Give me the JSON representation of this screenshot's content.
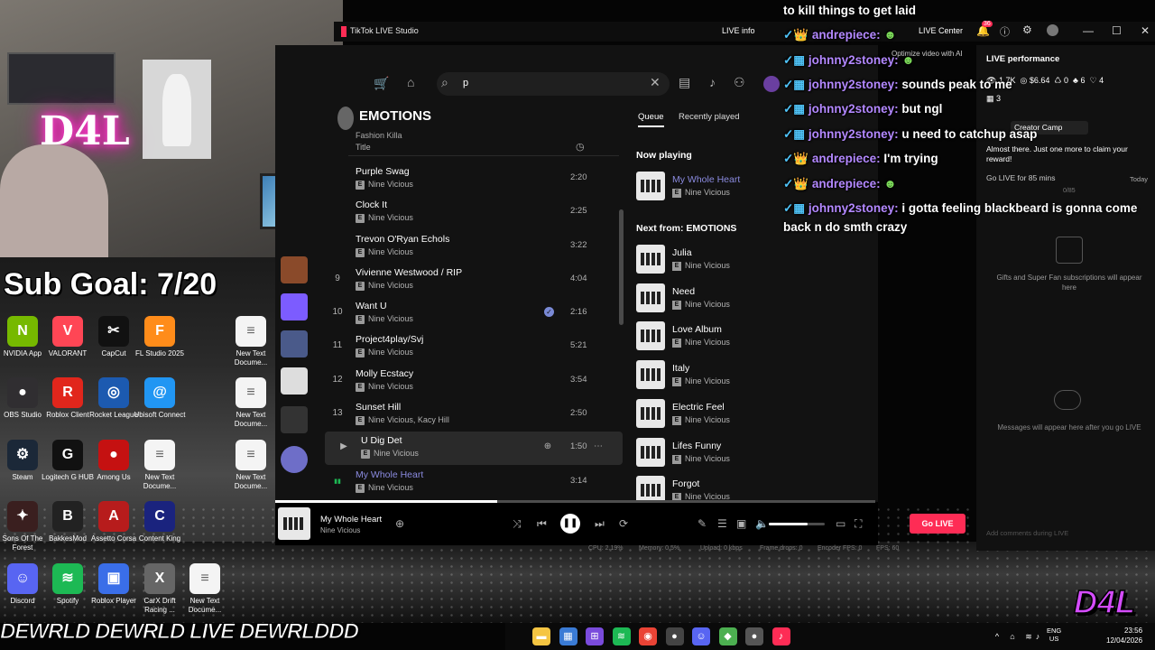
{
  "webcam": {
    "neon_sign": "D4L"
  },
  "overlay": {
    "sub_goal": "Sub Goal: 7/20"
  },
  "desktop_icons": [
    {
      "label": "NVIDIA App",
      "color": "#76b900",
      "glyph": "N"
    },
    {
      "label": "VALORANT",
      "color": "#ff4655",
      "glyph": "V"
    },
    {
      "label": "CapCut",
      "color": "#111111",
      "glyph": "✂"
    },
    {
      "label": "FL Studio 2025",
      "color": "#ff8c1a",
      "glyph": "F"
    },
    {
      "label": "New Text Docume...",
      "color": "#f4f4f4",
      "glyph": "≡"
    },
    {
      "label": "OBS Studio",
      "color": "#302e31",
      "glyph": "●"
    },
    {
      "label": "Roblox Client",
      "color": "#e1261c",
      "glyph": "R"
    },
    {
      "label": "Rocket League",
      "color": "#1c5ab0",
      "glyph": "◎"
    },
    {
      "label": "Ubisoft Connect",
      "color": "#2196f3",
      "glyph": "@"
    },
    {
      "label": "New Text Docume...",
      "color": "#f4f4f4",
      "glyph": "≡"
    },
    {
      "label": "Steam",
      "color": "#1b2838",
      "glyph": "⚙"
    },
    {
      "label": "Logitech G HUB",
      "color": "#111111",
      "glyph": "G"
    },
    {
      "label": "Among Us",
      "color": "#c51111",
      "glyph": "●"
    },
    {
      "label": "New Text Docume...",
      "color": "#f4f4f4",
      "glyph": "≡"
    },
    {
      "label": "New Text Docume...",
      "color": "#f4f4f4",
      "glyph": "≡"
    },
    {
      "label": "Sons Of The Forest",
      "color": "#3a1f1f",
      "glyph": "✦"
    },
    {
      "label": "BakkesMod",
      "color": "#222222",
      "glyph": "B"
    },
    {
      "label": "Assetto Corsa",
      "color": "#b71c1c",
      "glyph": "A"
    },
    {
      "label": "Content King",
      "color": "#1a237e",
      "glyph": "C"
    },
    {
      "label": "Discord",
      "color": "#5865f2",
      "glyph": "☺"
    },
    {
      "label": "Spotify",
      "color": "#1db954",
      "glyph": "≋"
    },
    {
      "label": "Roblox Player",
      "color": "#3a6ee8",
      "glyph": "▣"
    },
    {
      "label": "CarX Drift Racing ...",
      "color": "#666666",
      "glyph": "X"
    },
    {
      "label": "New Text Docume...",
      "color": "#f4f4f4",
      "glyph": "≡"
    }
  ],
  "tiktok": {
    "app_title": "TikTok LIVE Studio",
    "live_info": "LIVE info",
    "live_center": "LIVE Center",
    "notification_count": "36",
    "optimize_label": "Optimize video with AI",
    "live_performance": "LIVE performance",
    "stats": {
      "viewers": "1.7K",
      "earnings": "$6.64",
      "shares": "0",
      "gifts": "6",
      "likes": "4",
      "fans": "3"
    },
    "creator_camp": "Creator Camp",
    "camp_message": "Almost there. Just one more to claim your reward!",
    "go_live_for": "Go LIVE for 85 mins",
    "today": "Today",
    "progress_label": "0/85",
    "gifts_placeholder": "Gifts and Super Fan subscriptions will appear here",
    "messages_placeholder": "Messages will appear here after you go LIVE",
    "comment_placeholder": "Add comments during LIVE",
    "go_live_button": "Go LIVE",
    "status": {
      "cpu": "CPU: 2.19%",
      "memory": "Memory: 0.5%",
      "upload": "Upload: 0 kbps",
      "frame_drops": "Frame drops: 0",
      "encoder_fps": "Encoder FPS: 0",
      "fps": "FPS: 60"
    }
  },
  "spotify": {
    "search_value": "p",
    "album_title": "EMOTIONS",
    "album_subtitle": "Fashion Killa",
    "col_title": "Title",
    "tracks": [
      {
        "num": "",
        "title": "Purple Swag",
        "artist": "Nine Vicious",
        "duration": "2:20"
      },
      {
        "num": "",
        "title": "Clock It",
        "artist": "Nine Vicious",
        "duration": "2:25"
      },
      {
        "num": "",
        "title": "Trevon O'Ryan Echols",
        "artist": "Nine Vicious",
        "duration": "3:22"
      },
      {
        "num": "9",
        "title": "Vivienne Westwood / RIP",
        "artist": "Nine Vicious",
        "duration": "4:04"
      },
      {
        "num": "10",
        "title": "Want U",
        "artist": "Nine Vicious",
        "duration": "2:16"
      },
      {
        "num": "11",
        "title": "Project4play/Svj",
        "artist": "Nine Vicious",
        "duration": "5:21"
      },
      {
        "num": "12",
        "title": "Molly Ecstacy",
        "artist": "Nine Vicious",
        "duration": "3:54"
      },
      {
        "num": "13",
        "title": "Sunset Hill",
        "artist": "Nine Vicious, Kacy Hill",
        "duration": "2:50"
      },
      {
        "num": "",
        "title": "U Dig Det",
        "artist": "Nine Vicious",
        "duration": "1:50"
      },
      {
        "num": "",
        "title": "My Whole Heart",
        "artist": "Nine Vicious",
        "duration": "3:14"
      }
    ],
    "queue_tab": "Queue",
    "recent_tab": "Recently played",
    "now_playing_label": "Now playing",
    "now_playing": {
      "title": "My Whole Heart",
      "artist": "Nine Vicious"
    },
    "next_from_label": "Next from: EMOTIONS",
    "queue": [
      {
        "title": "Julia",
        "artist": "Nine Vicious"
      },
      {
        "title": "Need",
        "artist": "Nine Vicious"
      },
      {
        "title": "Love Album",
        "artist": "Nine Vicious"
      },
      {
        "title": "Italy",
        "artist": "Nine Vicious"
      },
      {
        "title": "Electric Feel",
        "artist": "Nine Vicious"
      },
      {
        "title": "Lifes Funny",
        "artist": "Nine Vicious"
      },
      {
        "title": "Forgot",
        "artist": "Nine Vicious"
      }
    ],
    "player": {
      "title": "My Whole Heart",
      "artist": "Nine Vicious",
      "progress": 0.37,
      "volume": 0.7
    }
  },
  "chat": [
    {
      "user": "",
      "message": "to kill things to get laid"
    },
    {
      "user": "andrepiece:",
      "message": ""
    },
    {
      "user": "johnny2stoney:",
      "message": ""
    },
    {
      "user": "johnny2stoney:",
      "message": "sounds peak to me"
    },
    {
      "user": "johnny2stoney:",
      "message": "but ngl"
    },
    {
      "user": "johnny2stoney:",
      "message": "u need to catchup asap"
    },
    {
      "user": "andrepiece:",
      "message": "I'm trying"
    },
    {
      "user": "andrepiece:",
      "message": ""
    },
    {
      "user": "johnny2stoney:",
      "message": "i gotta feeling blackbeard is gonna come"
    },
    {
      "user": "",
      "message": "back n do smth crazy"
    }
  ],
  "socials": "DEWRLD  DEWRLD LIVE  DEWRLDDD",
  "taskbar": {
    "lang_top": "ENG",
    "lang_bottom": "US",
    "time": "23:56",
    "date": "12/04/2026"
  },
  "brand_logo": "D4L"
}
